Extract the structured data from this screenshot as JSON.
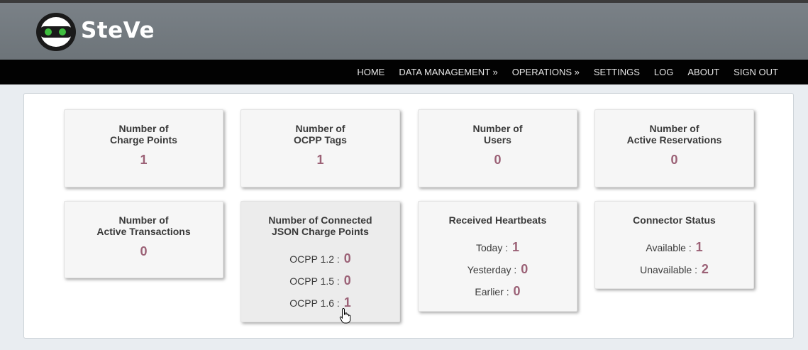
{
  "app": {
    "name": "SteVe"
  },
  "nav": [
    "HOME",
    "DATA MANAGEMENT »",
    "OPERATIONS »",
    "SETTINGS",
    "LOG",
    "ABOUT",
    "SIGN OUT"
  ],
  "cards": {
    "charge_points": {
      "line1": "Number of",
      "line2": "Charge Points",
      "value": "1"
    },
    "ocpp_tags": {
      "line1": "Number of",
      "line2": "OCPP Tags",
      "value": "1"
    },
    "users": {
      "line1": "Number of",
      "line2": "Users",
      "value": "0"
    },
    "reservations": {
      "line1": "Number of",
      "line2": "Active Reservations",
      "value": "0"
    },
    "transactions": {
      "line1": "Number of",
      "line2": "Active Transactions",
      "value": "0"
    },
    "json_cps": {
      "line1": "Number of Connected",
      "line2": "JSON Charge Points",
      "rows": [
        {
          "label": "OCPP 1.2 :",
          "value": "0"
        },
        {
          "label": "OCPP 1.5 :",
          "value": "0"
        },
        {
          "label": "OCPP 1.6 :",
          "value": "1"
        }
      ]
    },
    "heartbeats": {
      "title": "Received Heartbeats",
      "rows": [
        {
          "label": "Today :",
          "value": "1"
        },
        {
          "label": "Yesterday :",
          "value": "0"
        },
        {
          "label": "Earlier :",
          "value": "0"
        }
      ]
    },
    "connector_status": {
      "title": "Connector Status",
      "rows": [
        {
          "label": "Available :",
          "value": "1"
        },
        {
          "label": "Unavailable :",
          "value": "2"
        }
      ]
    }
  },
  "colors": {
    "header": "#6d7479",
    "navbar": "#020202",
    "value": "#9b6176",
    "logo_eyes": "#3fbf3f"
  }
}
